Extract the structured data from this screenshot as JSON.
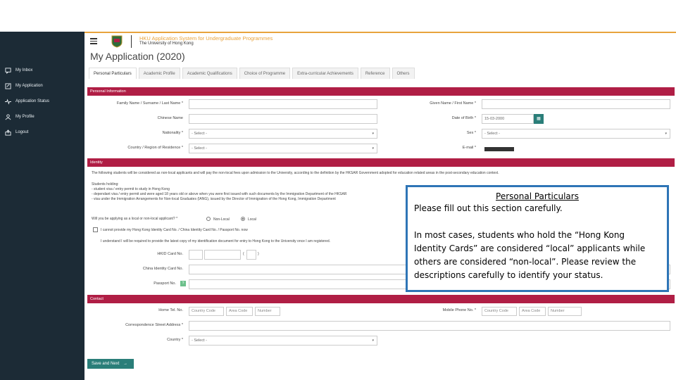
{
  "sidebar": {
    "items": [
      {
        "label": "My Inbox",
        "icon": "inbox-icon"
      },
      {
        "label": "My Application",
        "icon": "edit-icon"
      },
      {
        "label": "Application Status",
        "icon": "pulse-icon"
      },
      {
        "label": "My Profile",
        "icon": "user-icon"
      },
      {
        "label": "Logout",
        "icon": "logout-icon"
      }
    ]
  },
  "header": {
    "app_name": "HKU Application System for Undergraduate Programmes",
    "university": "The University of Hong Kong"
  },
  "page_title": "My Application (2020)",
  "tabs": [
    {
      "label": "Personal Particulars"
    },
    {
      "label": "Academic Profile"
    },
    {
      "label": "Academic Qualifications"
    },
    {
      "label": "Choice of Programme"
    },
    {
      "label": "Extra-curricular Achievements"
    },
    {
      "label": "Reference"
    },
    {
      "label": "Others"
    }
  ],
  "personal": {
    "section_title": "Personal Information",
    "family_name_label": "Family Name / Surname / Last Name *",
    "given_name_label": "Given Name / First Name *",
    "chinese_name_label": "Chinese Name",
    "dob_label": "Date of Birth *",
    "dob_value": "15-03-2000",
    "nationality_label": "Nationality *",
    "nationality_value": "- Select -",
    "sex_label": "Sex *",
    "sex_value": "- Select -",
    "residence_label": "Country / Region of Residence *",
    "residence_value": "- Select -",
    "email_label": "E-mail *"
  },
  "identity": {
    "section_title": "Identity",
    "intro": "The following students will be considered as non-local applicants and will pay the non-local fees upon admission to the University, according to the definition by the HKSAR Government adopted for education related areas in the post-secondary education context.",
    "students_holding": "Students holding:",
    "bullet1": "- student visa / entry permit to study in Hong Kong",
    "bullet2": "- dependant visa / entry permit and were aged 18 years old or above when you were first issued with such documents by the Immigration Department of the HKSAR",
    "bullet3": "- visa under the Immigration Arrangements for Non-local Graduates (IANG), issued by the Director of Immigration of the Hong Kong, Immigration Department",
    "question": "Will you be applying as a local or non-local applicant? *",
    "opt_nonlocal": "Non-Local",
    "opt_local": "Local",
    "cannot_provide": "I cannot provide my Hong Kong Identity Card No. / China Identity Card No. / Passport No. now",
    "understand": "I understand I will be required to provide the latest copy of my identification document for entry to Hong Kong to the University once I am registered.",
    "hkid_label": "HKID Card No.",
    "china_id_label": "China Identity Card No.",
    "passport_label": "Passport No.",
    "hkid_bracket_open": "(",
    "hkid_bracket_close": ")",
    "help": "?"
  },
  "contact": {
    "section_title": "Contact",
    "home_tel_label": "Home Tel. No.",
    "mobile_label": "Mobile Phone No. *",
    "country_code": "Country Code",
    "area_code": "Area Code",
    "number": "Number",
    "address_label": "Correspondence Street Address *",
    "country_label": "Country *",
    "country_value": "- Select -"
  },
  "save_button": "Save and Next",
  "callout": {
    "title": "Personal Particulars",
    "line1": "Please fill out this section carefully.",
    "line2": "In most cases, students who hold the “Hong Kong",
    "line3": "Identity Cards” are considered “local” applicants while",
    "line4": "others are considered “non-local”.  Please review the",
    "line5": "descriptions carefully to identify your status."
  }
}
